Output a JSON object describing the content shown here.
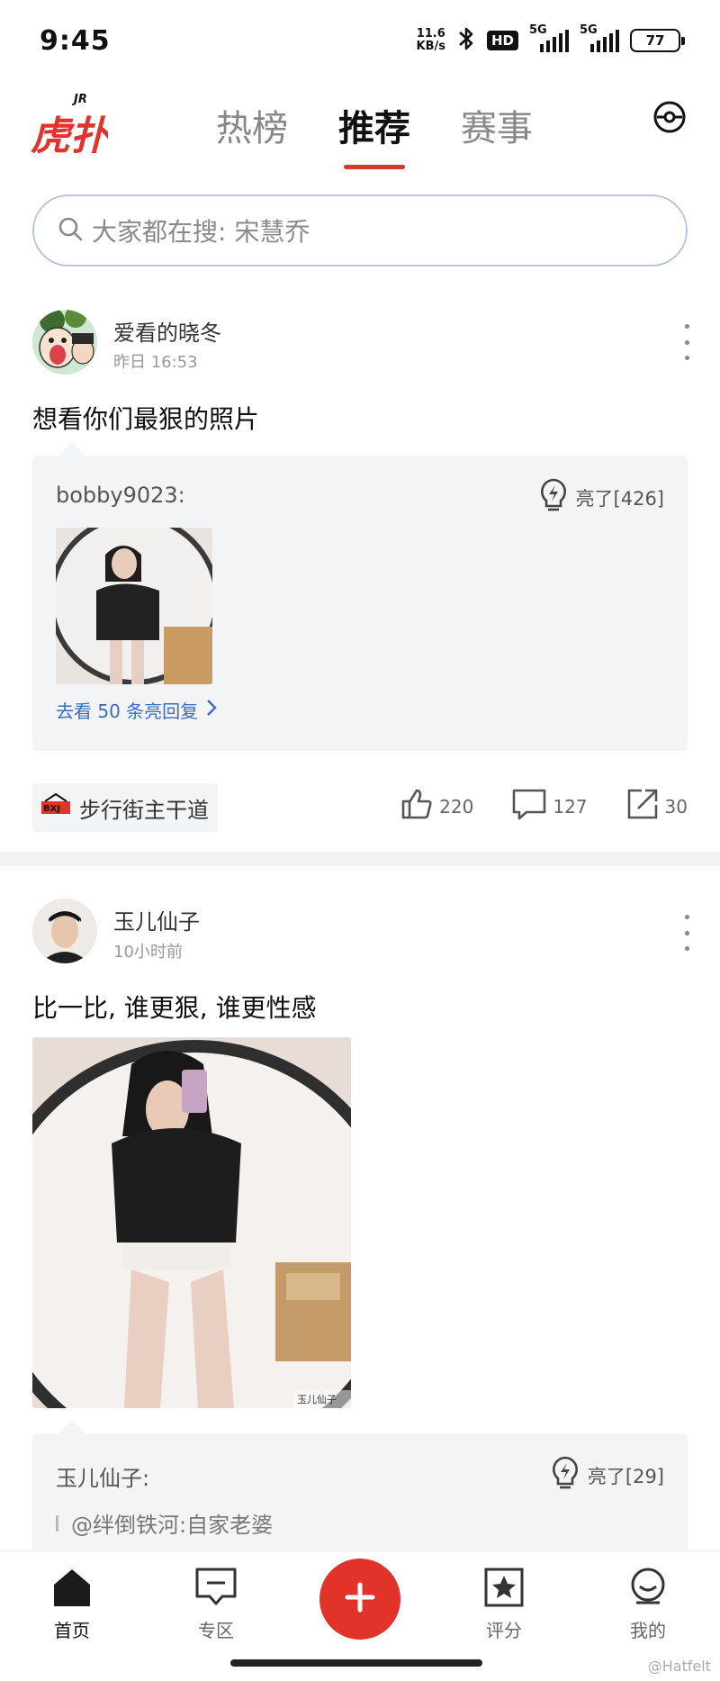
{
  "status": {
    "time": "9:45",
    "speed_top": "11.6",
    "speed_unit": "KB/s",
    "hd": "HD",
    "net1": "5G",
    "net2": "5G",
    "battery": "77"
  },
  "header": {
    "logo_text": "虎扑",
    "logo_badge": "JR",
    "tabs": [
      {
        "label": "热榜"
      },
      {
        "label": "推荐"
      },
      {
        "label": "赛事"
      }
    ],
    "active_tab": "推荐"
  },
  "search": {
    "placeholder": "大家都在搜: 宋慧乔"
  },
  "posts": [
    {
      "user": "爱看的晓冬",
      "time": "昨日 16:53",
      "title": "想看你们最狠的照片",
      "reply": {
        "user": "bobby9023:",
        "light": "亮了[426]",
        "more_link": "去看 50 条亮回复"
      },
      "forum": "步行街主干道",
      "likes": "220",
      "comments": "127",
      "shares": "30"
    },
    {
      "user": "玉儿仙子",
      "time": "10小时前",
      "title": "比一比, 谁更狠, 谁更性感",
      "photo_watermark": "玉儿仙子",
      "reply": {
        "user": "玉儿仙子:",
        "light": "亮了[29]",
        "quote": "@绊倒铁河:自家老婆"
      }
    }
  ],
  "nav": {
    "items": [
      {
        "label": "首页"
      },
      {
        "label": "专区"
      },
      {
        "label": "评分"
      },
      {
        "label": "我的"
      }
    ],
    "watermark": "@Hatfelt"
  },
  "colors": {
    "accent": "#e2332b",
    "link": "#3a6cc4",
    "tab_underline": "#d23a2e"
  }
}
